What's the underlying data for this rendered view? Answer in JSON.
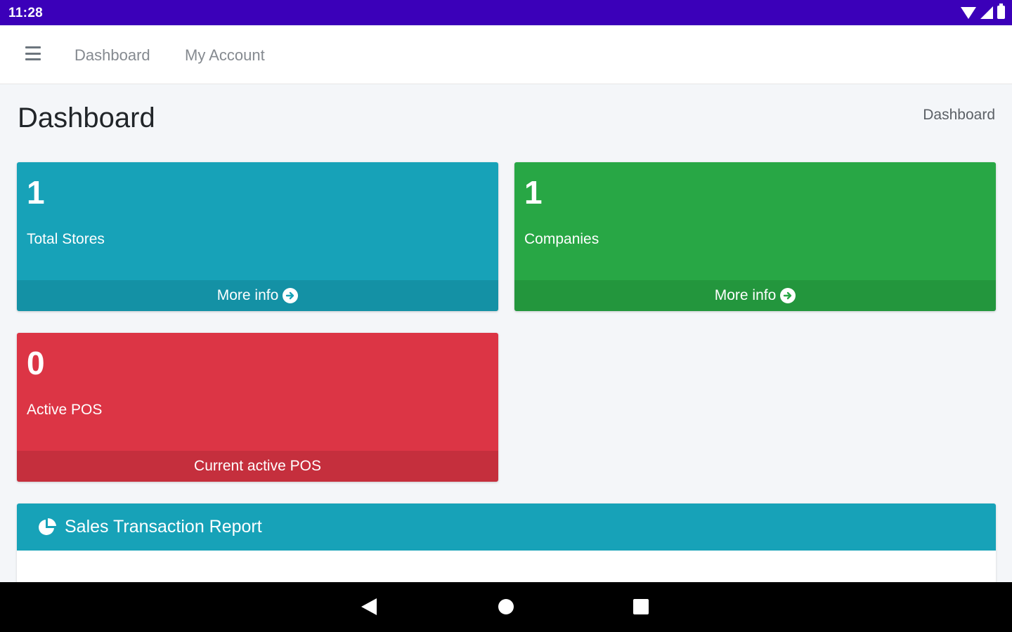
{
  "status_bar": {
    "time": "11:28"
  },
  "topnav": {
    "links": [
      "Dashboard",
      "My Account"
    ]
  },
  "page": {
    "title": "Dashboard",
    "breadcrumb": "Dashboard"
  },
  "boxes": [
    {
      "value": "1",
      "label": "Total Stores",
      "footer": "More info",
      "color": "#17a2b8"
    },
    {
      "value": "1",
      "label": "Companies",
      "footer": "More info",
      "color": "#28a745"
    },
    {
      "value": "0",
      "label": "Active POS",
      "footer": "Current active POS",
      "color": "#dc3545"
    }
  ],
  "report_card": {
    "title": "Sales Transaction Report",
    "icon": "pie-chart-icon",
    "color": "#17a2b8"
  },
  "colors": {
    "status_bar": "#3b00b9",
    "background": "#f4f6f9"
  }
}
